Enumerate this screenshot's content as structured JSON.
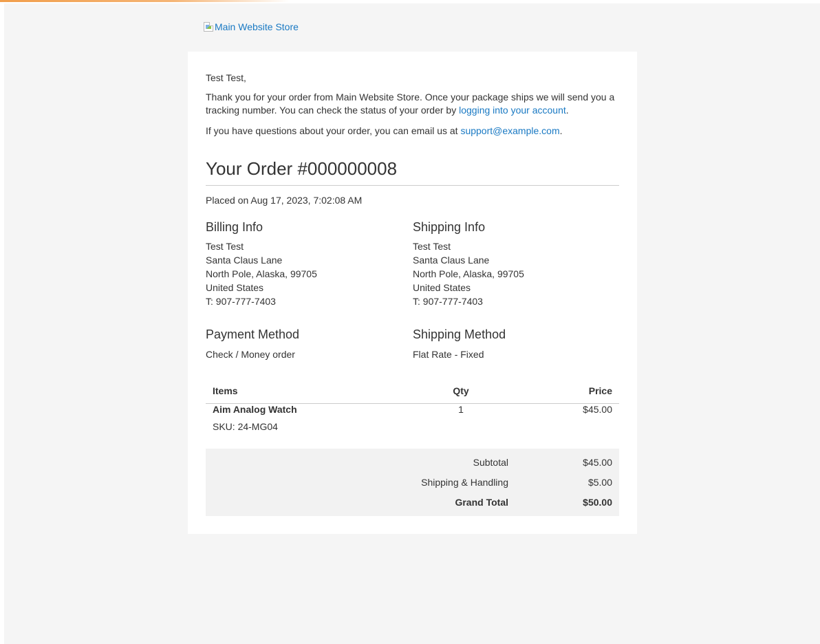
{
  "header": {
    "logo_alt": "Main Website Store"
  },
  "email": {
    "greeting": "Test Test,",
    "thanks_text": "Thank you for your order from Main Website Store. Once your package ships we will send you a tracking number. You can check the status of your order by ",
    "account_link": "logging into your account",
    "thanks_end": ".",
    "questions_text": "If you have questions about your order, you can email us at ",
    "support_email": "support@example.com",
    "questions_end": "."
  },
  "order": {
    "title": "Your Order #000000008",
    "placed": "Placed on Aug 17, 2023, 7:02:08 AM"
  },
  "billing": {
    "heading": "Billing Info",
    "lines": [
      "Test Test",
      "Santa Claus Lane",
      "North Pole, Alaska, 99705",
      "United States",
      "T: 907-777-7403"
    ]
  },
  "shipping": {
    "heading": "Shipping Info",
    "lines": [
      "Test Test",
      "Santa Claus Lane",
      "North Pole, Alaska, 99705",
      "United States",
      "T: 907-777-7403"
    ]
  },
  "payment": {
    "heading": "Payment Method",
    "value": "Check / Money order"
  },
  "shipping_method": {
    "heading": "Shipping Method",
    "value": "Flat Rate - Fixed"
  },
  "items_table": {
    "headers": {
      "items": "Items",
      "qty": "Qty",
      "price": "Price"
    },
    "rows": [
      {
        "name": "Aim Analog Watch",
        "sku": "SKU: 24-MG04",
        "qty": "1",
        "price": "$45.00"
      }
    ]
  },
  "totals": {
    "subtotal_label": "Subtotal",
    "subtotal_value": "$45.00",
    "shipping_label": "Shipping & Handling",
    "shipping_value": "$5.00",
    "grand_label": "Grand Total",
    "grand_value": "$50.00"
  },
  "colors": {
    "link": "#1979c3",
    "background": "#f5f5f5",
    "card": "#ffffff",
    "totals_bg": "#f2f2f2"
  }
}
